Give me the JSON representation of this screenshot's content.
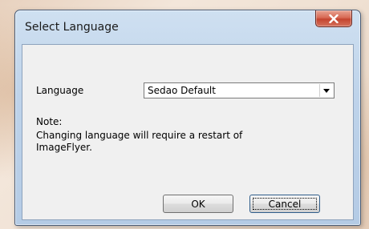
{
  "dialog": {
    "title": "Select Language",
    "close_icon": "close-x-icon"
  },
  "language": {
    "label": "Language",
    "selected": "Sedao Default",
    "dropdown_icon": "dropdown-arrow-icon"
  },
  "note": {
    "title": "Note:",
    "text": "Changing language will require a restart of ImageFlyer."
  },
  "buttons": {
    "ok": "OK",
    "cancel": "Cancel"
  },
  "colors": {
    "close_button": "#c4442f",
    "frame": "#b4cbe5",
    "client_bg": "#f0f0f0"
  }
}
